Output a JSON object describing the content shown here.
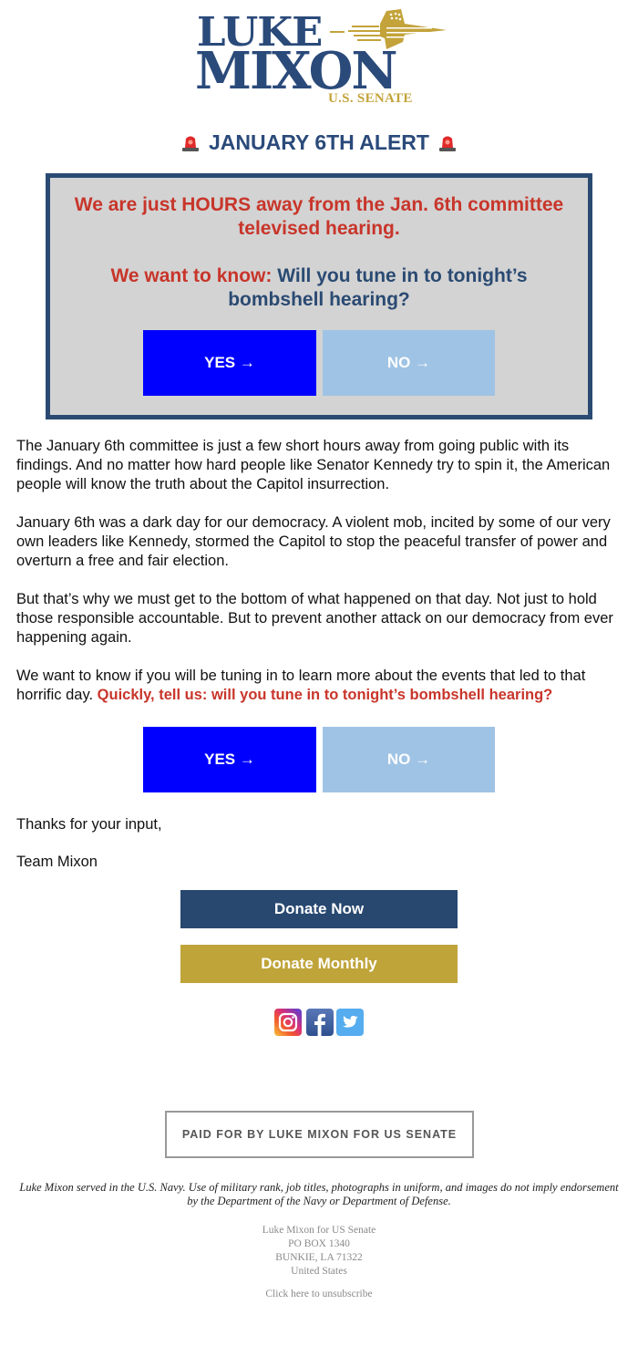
{
  "header": {
    "logo": {
      "line1": "LUKE",
      "line2": "MIXON",
      "subtitle": "U.S. SENATE",
      "colors": {
        "navy": "#2a4a7a",
        "gold": "#c3a33a"
      }
    },
    "alert_title": "JANUARY 6TH ALERT",
    "alert_icon": "police-siren-icon"
  },
  "alert_box": {
    "line1": "We are just HOURS away from the Jan. 6th committee televised hearing.",
    "question_lead": "We want to know:",
    "question": "Will you tune in to tonight’s bombshell hearing?",
    "yes_label": "YES →",
    "no_label": "NO →"
  },
  "body": {
    "paragraphs": [
      "The January 6th committee is just a few short hours away from going public with its findings. And no matter how hard people like Senator Kennedy try to spin it, the American people will know the truth about the Capitol insurrection.",
      "January 6th was a dark day for our democracy. A violent mob, incited by some of our very own leaders like Kennedy, stormed the Capitol to stop the peaceful transfer of power and overturn a free and fair election.",
      "But that’s why we must get to the bottom of what happened on that day. Not just to hold those responsible accountable. But to prevent another attack on our democracy from ever happening again."
    ],
    "last_paragraph": {
      "text": "We want to know if you will be tuning in to learn more about the events that led to that horrific day.",
      "highlight": "Quickly, tell us: will you tune in to tonight’s bombshell hearing?"
    },
    "yes_label": "YES →",
    "no_label": "NO →",
    "signoff": "Thanks for your input,",
    "signature": "Team Mixon"
  },
  "donate": {
    "now_label": "Donate Now",
    "monthly_label": "Donate Monthly",
    "colors": {
      "now": "#284870",
      "monthly": "#bfa43a"
    }
  },
  "social": [
    {
      "name": "Instagram",
      "icon": "instagram-icon"
    },
    {
      "name": "Facebook",
      "icon": "facebook-icon"
    },
    {
      "name": "Twitter",
      "icon": "twitter-icon"
    }
  ],
  "footer": {
    "paid_for": "PAID FOR BY LUKE MIXON FOR US SENATE",
    "disclaimer": "Luke Mixon served in the U.S. Navy. Use of military rank, job titles, photographs in uniform, and images do not imply endorsement by the Department of the Navy or Department of Defense.",
    "address": [
      "Luke Mixon for US Senate",
      "PO BOX 1340",
      "BUNKIE, LA 71322",
      "United States"
    ],
    "unsubscribe": "Click here to unsubscribe"
  }
}
